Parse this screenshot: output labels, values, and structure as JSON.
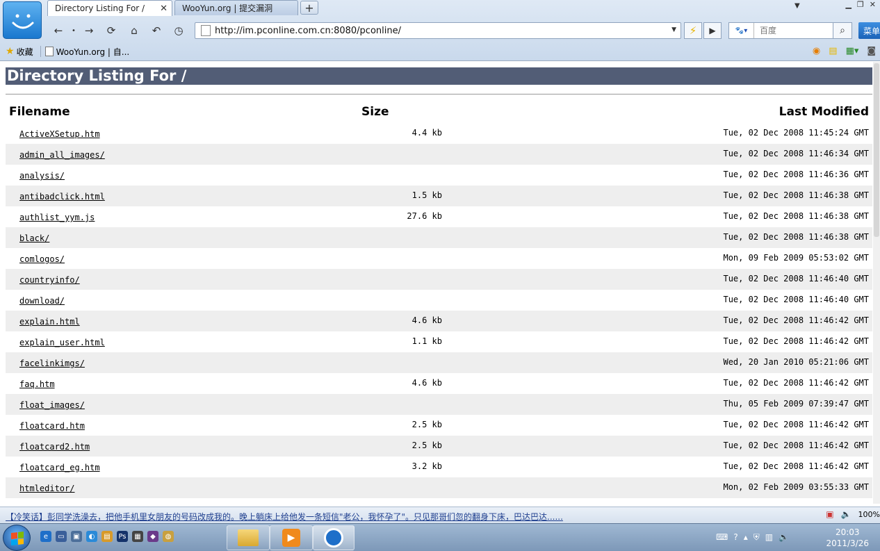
{
  "browser": {
    "tabs": [
      {
        "label": "Directory Listing For /",
        "active": true
      },
      {
        "label": "WooYun.org | 提交漏洞",
        "active": false
      }
    ],
    "address": "http://im.pconline.com.cn:8080/pconline/",
    "search_placeholder": "百度",
    "menu_label": "菜单",
    "favorites_label": "收藏",
    "bookmark": "WooYun.org | 自...",
    "zoom": "100%"
  },
  "page": {
    "title": "Directory Listing For /",
    "headers": {
      "filename": "Filename",
      "size": "Size",
      "modified": "Last Modified"
    },
    "files": [
      {
        "name": "ActiveXSetup.htm",
        "size": "4.4 kb",
        "modified": "Tue, 02 Dec 2008 11:45:24 GMT"
      },
      {
        "name": "admin_all_images/",
        "size": "",
        "modified": "Tue, 02 Dec 2008 11:46:34 GMT"
      },
      {
        "name": "analysis/",
        "size": "",
        "modified": "Tue, 02 Dec 2008 11:46:36 GMT"
      },
      {
        "name": "antibadclick.html",
        "size": "1.5 kb",
        "modified": "Tue, 02 Dec 2008 11:46:38 GMT"
      },
      {
        "name": "authlist_yym.js",
        "size": "27.6 kb",
        "modified": "Tue, 02 Dec 2008 11:46:38 GMT"
      },
      {
        "name": "black/",
        "size": "",
        "modified": "Tue, 02 Dec 2008 11:46:38 GMT"
      },
      {
        "name": "comlogos/",
        "size": "",
        "modified": "Mon, 09 Feb 2009 05:53:02 GMT"
      },
      {
        "name": "countryinfo/",
        "size": "",
        "modified": "Tue, 02 Dec 2008 11:46:40 GMT"
      },
      {
        "name": "download/",
        "size": "",
        "modified": "Tue, 02 Dec 2008 11:46:40 GMT"
      },
      {
        "name": "explain.html",
        "size": "4.6 kb",
        "modified": "Tue, 02 Dec 2008 11:46:42 GMT"
      },
      {
        "name": "explain_user.html",
        "size": "1.1 kb",
        "modified": "Tue, 02 Dec 2008 11:46:42 GMT"
      },
      {
        "name": "facelinkimgs/",
        "size": "",
        "modified": "Wed, 20 Jan 2010 05:21:06 GMT"
      },
      {
        "name": "faq.htm",
        "size": "4.6 kb",
        "modified": "Tue, 02 Dec 2008 11:46:42 GMT"
      },
      {
        "name": "float_images/",
        "size": "",
        "modified": "Thu, 05 Feb 2009 07:39:47 GMT"
      },
      {
        "name": "floatcard.htm",
        "size": "2.5 kb",
        "modified": "Tue, 02 Dec 2008 11:46:42 GMT"
      },
      {
        "name": "floatcard2.htm",
        "size": "2.5 kb",
        "modified": "Tue, 02 Dec 2008 11:46:42 GMT"
      },
      {
        "name": "floatcard_eg.htm",
        "size": "3.2 kb",
        "modified": "Tue, 02 Dec 2008 11:46:42 GMT"
      },
      {
        "name": "htmleditor/",
        "size": "",
        "modified": "Mon, 02 Feb 2009 03:55:33 GMT"
      }
    ]
  },
  "status_bar": {
    "text": "【冷笑话】彭同学洗澡去，把他手机里女朋友的号码改成我的。晚上躺床上给他发一条短信\"老公，我怀孕了\"。只见那哥们忽的翻身下床，巴达巴达......"
  },
  "taskbar": {
    "time": "20:03",
    "date": "2011/3/26"
  },
  "colors": {
    "title_bar": "#525d76",
    "alt_row": "#eeeeee",
    "taskbar": "#8aa4c2"
  }
}
